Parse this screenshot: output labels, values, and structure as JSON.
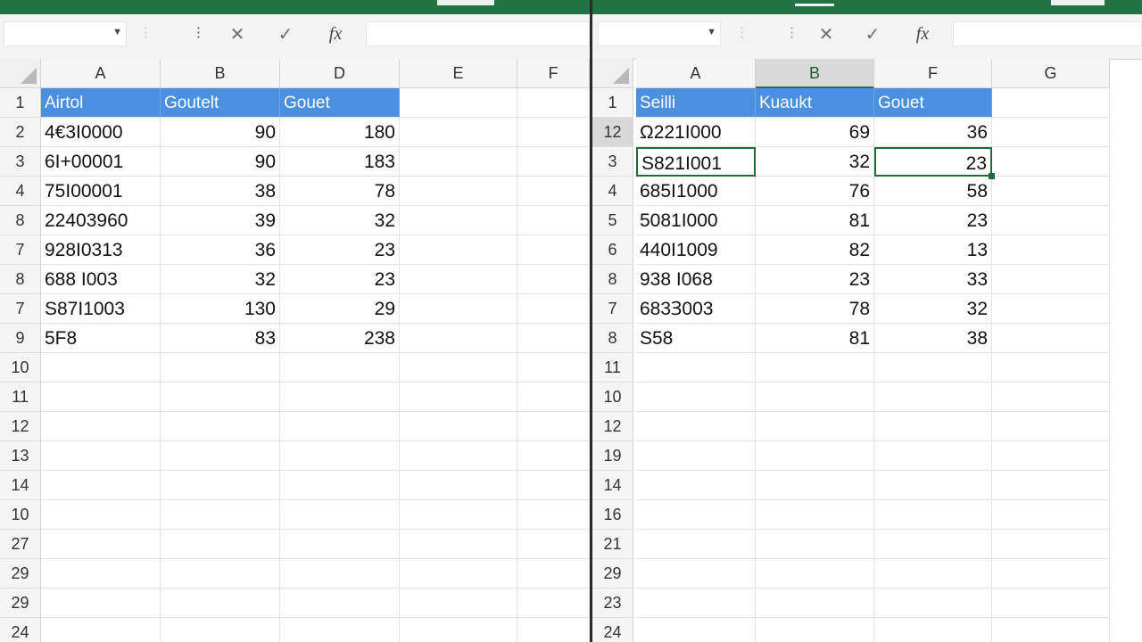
{
  "accent_color": "#217346",
  "header_fill_color": "#4a8fe0",
  "left": {
    "formula_bar": {
      "dropdown_icon": "chevron-down-icon",
      "cancel_icon": "close-icon",
      "enter_icon": "check-icon",
      "function_label": "fx",
      "name_box": "",
      "formula": ""
    },
    "columns": [
      "A",
      "B",
      "D",
      "E",
      "F"
    ],
    "row_numbers": [
      "1",
      "2",
      "3",
      "4",
      "8",
      "7",
      "8",
      "7",
      "9",
      "10",
      "11",
      "12",
      "13",
      "14",
      "10",
      "27",
      "29",
      "29",
      "24"
    ],
    "table": {
      "headers": [
        "Airtol",
        "Goutelt",
        "Gouet"
      ],
      "rows": [
        [
          "4€3I0000",
          "90",
          "180"
        ],
        [
          "6I+00001",
          "90",
          "183"
        ],
        [
          "75I00001",
          "38",
          "78"
        ],
        [
          "22403960",
          "39",
          "32"
        ],
        [
          "928I0313",
          "36",
          "23"
        ],
        [
          "688 I003",
          "32",
          "23"
        ],
        [
          "S87I1003",
          "130",
          "29"
        ],
        [
          "5F8",
          "83",
          "238"
        ]
      ]
    }
  },
  "right": {
    "formula_bar": {
      "dropdown_icon": "chevron-down-icon",
      "cancel_icon": "close-icon",
      "enter_icon": "check-icon",
      "function_label": "fx",
      "name_box": "",
      "formula": ""
    },
    "columns": [
      "A",
      "B",
      "F",
      "G"
    ],
    "selected_column": "B",
    "row_numbers": [
      "1",
      "12",
      "3",
      "4",
      "5",
      "6",
      "8",
      "7",
      "8",
      "11",
      "10",
      "12",
      "19",
      "14",
      "16",
      "21",
      "29",
      "23",
      "24"
    ],
    "selected_row": "12",
    "table": {
      "headers": [
        "Seilli",
        "Kuaukt",
        "Gouet"
      ],
      "rows": [
        [
          "Ω221I000",
          "69",
          "36"
        ],
        [
          "S821I001",
          "32",
          "23"
        ],
        [
          "685I1000",
          "76",
          "58"
        ],
        [
          "5081I000",
          "81",
          "23"
        ],
        [
          "440I1009",
          "82",
          "13"
        ],
        [
          "938 I068",
          "23",
          "33"
        ],
        [
          "683Ɜ003",
          "78",
          "32"
        ],
        [
          "S58",
          "81",
          "38"
        ]
      ]
    }
  }
}
